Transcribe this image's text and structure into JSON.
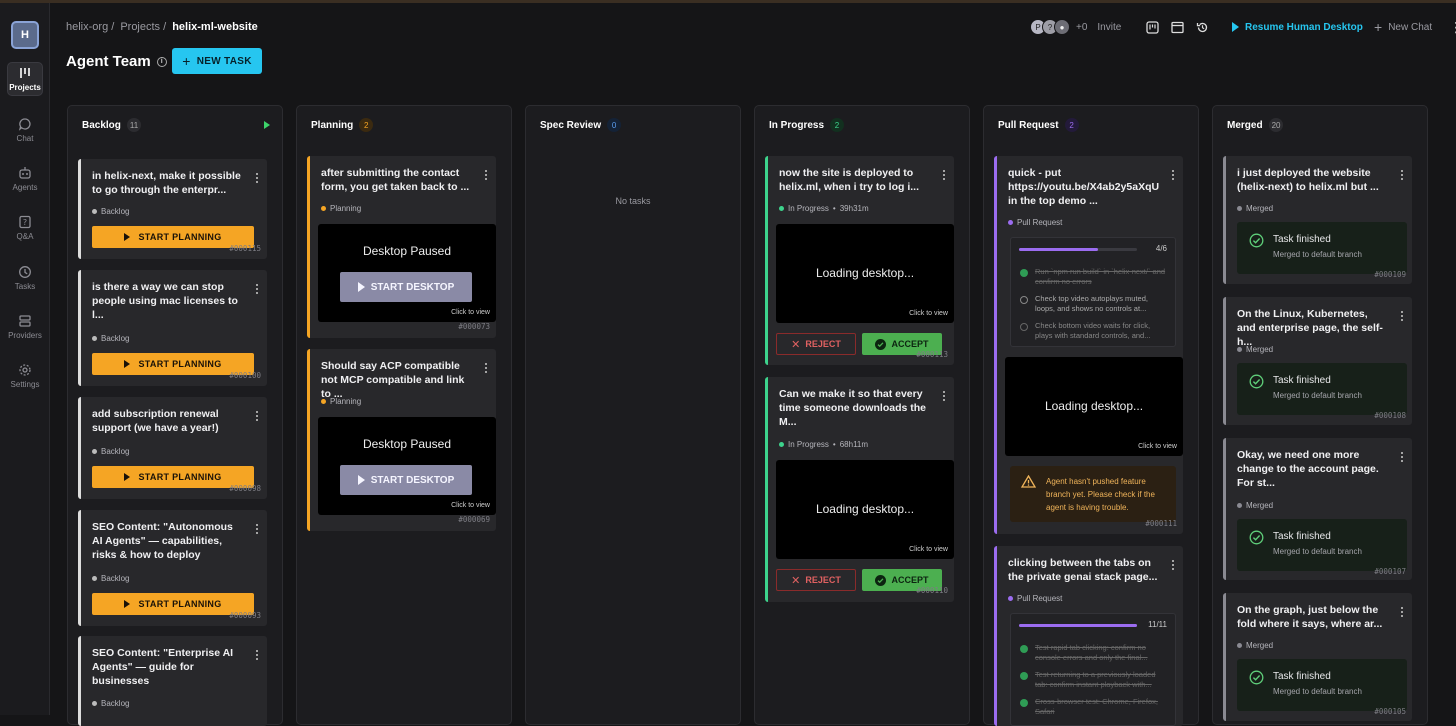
{
  "sidebar": {
    "logo": "H",
    "items": [
      {
        "label": "Projects",
        "icon": "projects-icon"
      },
      {
        "label": "Chat",
        "icon": "chat-icon"
      },
      {
        "label": "Agents",
        "icon": "robot-icon"
      },
      {
        "label": "Q&A",
        "icon": "question-icon"
      },
      {
        "label": "Tasks",
        "icon": "clock-icon"
      },
      {
        "label": "Providers",
        "icon": "server-icon"
      },
      {
        "label": "Settings",
        "icon": "gear-icon"
      }
    ]
  },
  "header": {
    "crumb_org": "helix-org",
    "crumb_sep": "/",
    "crumb_projects": "Projects",
    "crumb_current": "helix-ml-website",
    "title": "Agent Team",
    "new_task": "NEW TASK",
    "avatars": [
      "P",
      "?"
    ],
    "extra": "+0",
    "invite": "Invite",
    "resume": "Resume Human Desktop",
    "new_chat": "New Chat"
  },
  "columns": [
    {
      "name": "Backlog",
      "count": "11",
      "cards": [
        {
          "title": "in helix-next, make it possible to go through the enterpr...",
          "status": "Backlog",
          "button": "START PLANNING",
          "id": "#000115"
        },
        {
          "title": "is there a way we can stop people using mac licenses to l...",
          "status": "Backlog",
          "button": "START PLANNING",
          "id": "#000100"
        },
        {
          "title": "add subscription renewal support (we have a year!)",
          "status": "Backlog",
          "button": "START PLANNING",
          "id": "#000098"
        },
        {
          "title": "SEO Content: \"Autonomous AI Agents\" — capabilities, risks & how to deploy",
          "status": "Backlog",
          "button": "START PLANNING",
          "id": "#000093"
        },
        {
          "title": "SEO Content: \"Enterprise AI Agents\" — guide for businesses",
          "status": "Backlog"
        }
      ]
    },
    {
      "name": "Planning",
      "count": "2",
      "cards": [
        {
          "title": "after submitting the contact form, you get taken back to ...",
          "status": "Planning",
          "screen": "Desktop Paused",
          "button": "START DESKTOP",
          "click": "Click to view",
          "id": "#000073"
        },
        {
          "title": "Should say ACP compatible not MCP compatible and link to ...",
          "status": "Planning",
          "screen": "Desktop Paused",
          "button": "START DESKTOP",
          "click": "Click to view",
          "id": "#000069"
        }
      ]
    },
    {
      "name": "Spec Review",
      "count": "0",
      "empty": "No tasks"
    },
    {
      "name": "In Progress",
      "count": "2",
      "cards": [
        {
          "title": "now the site is deployed to helix.ml, when i try to log i...",
          "status": "In Progress",
          "time": "39h31m",
          "screen": "Loading desktop...",
          "click": "Click to view",
          "reject": "REJECT",
          "accept": "ACCEPT",
          "id": "#000113"
        },
        {
          "title": "Can we make it so that every time someone downloads the M...",
          "status": "In Progress",
          "time": "68h11m",
          "screen": "Loading desktop...",
          "click": "Click to view",
          "reject": "REJECT",
          "accept": "ACCEPT",
          "id": "#000110"
        }
      ]
    },
    {
      "name": "Pull Request",
      "count": "2",
      "cards": [
        {
          "title": "quick - put https://youtu.be/X4ab2y5aXqU in the top demo ...",
          "status": "Pull Request",
          "progress": {
            "count": "4/6",
            "fraction": 0.67,
            "items": [
              {
                "text": "Run `npm run build` in `helix-next/` and confirm no errors",
                "done": true
              },
              {
                "text": "Check top video autoplays muted, loops, and shows no controls at...",
                "done": false
              },
              {
                "text": "Check bottom video waits for click, plays with standard controls, and...",
                "done": false
              }
            ]
          },
          "screen": "Loading desktop...",
          "click": "Click to view",
          "warning": "Agent hasn't pushed feature branch yet. Please check if the agent is having trouble.",
          "id": "#000111"
        },
        {
          "title": "clicking between the tabs on the private genai stack page...",
          "status": "Pull Request",
          "progress": {
            "count": "11/11",
            "fraction": 1.0,
            "items": [
              {
                "text": "Test rapid tab clicking: confirm no console errors and only the final...",
                "done": true
              },
              {
                "text": "Test returning to a previously loaded tab: confirm instant playback with...",
                "done": true
              },
              {
                "text": "Cross-browser test: Chrome, Firefox, Safari",
                "done": true
              }
            ]
          }
        }
      ]
    },
    {
      "name": "Merged",
      "count": "20",
      "cards": [
        {
          "title": "i just deployed the website (helix-next) to helix.ml but ...",
          "status": "Merged",
          "done_title": "Task finished",
          "done_sub": "Merged to default branch",
          "id": "#000109"
        },
        {
          "title": "On the Linux, Kubernetes, and enterprise page, the self-h...",
          "status": "Merged",
          "done_title": "Task finished",
          "done_sub": "Merged to default branch",
          "id": "#000108"
        },
        {
          "title": "Okay, we need one more change to the account page. For st...",
          "status": "Merged",
          "done_title": "Task finished",
          "done_sub": "Merged to default branch",
          "id": "#000107"
        },
        {
          "title": "On the graph, just below the fold where it says, where ar...",
          "status": "Merged",
          "done_title": "Task finished",
          "done_sub": "Merged to default branch",
          "id": "#000105"
        }
      ]
    }
  ],
  "colors": {
    "accent": "#26c6f0",
    "backlog": "#ffffff",
    "planning": "#f5a524",
    "in_progress": "#3dd38c",
    "pull_request": "#9b6cf0",
    "merged": "#8a8a92"
  }
}
